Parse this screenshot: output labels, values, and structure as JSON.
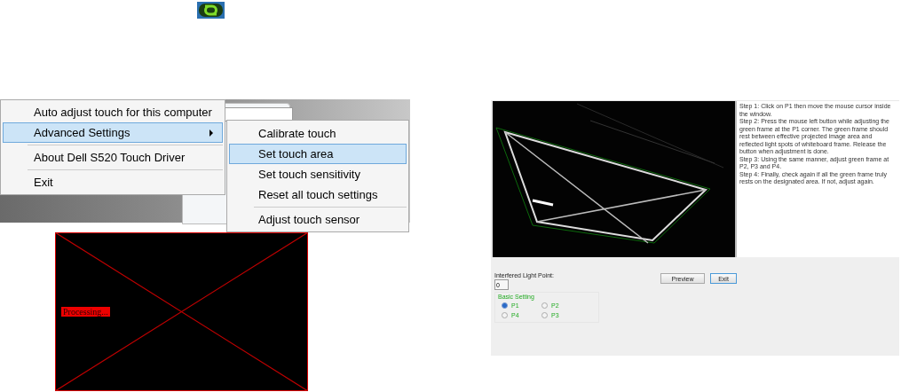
{
  "menu": {
    "groups": [
      [
        {
          "label": "Auto adjust touch for this computer",
          "selected": false,
          "has_submenu": false
        },
        {
          "label": "Advanced Settings",
          "selected": true,
          "has_submenu": true
        }
      ],
      [
        {
          "label": "About Dell S520 Touch Driver",
          "selected": false,
          "has_submenu": false
        }
      ],
      [
        {
          "label": "Exit",
          "selected": false,
          "has_submenu": false
        }
      ]
    ]
  },
  "submenu": {
    "groups": [
      [
        {
          "label": "Calibrate touch",
          "selected": false
        },
        {
          "label": "Set touch area",
          "selected": true
        },
        {
          "label": "Set touch sensitivity",
          "selected": false
        },
        {
          "label": "Reset all touch settings",
          "selected": false
        }
      ],
      [
        {
          "label": "Adjust touch sensor",
          "selected": false
        }
      ]
    ]
  },
  "processing": {
    "label": "Processing..."
  },
  "touch_area": {
    "instructions": [
      "Step 1: Click on P1 then move the mouse cursor inside the window.",
      "Step 2: Press the mouse left button while adjusting the green frame at the P1 corner. The green frame should rest between effective projected image area and reflected light spots of whiteboard frame. Release the button when adjustment is done.",
      "Step 3: Using the same manner, adjust green frame at P2, P3 and P4.",
      "Step 4: Finally, check again if all the green frame truly rests on the designated area. If not, adjust again."
    ],
    "light_point": {
      "label": "Interfered Light Point:",
      "value": "0"
    },
    "basic_setting": {
      "title": "Basic Setting",
      "options": [
        {
          "label": "P1",
          "selected": true
        },
        {
          "label": "P2",
          "selected": false
        },
        {
          "label": "P4",
          "selected": false
        },
        {
          "label": "P3",
          "selected": false
        }
      ]
    },
    "buttons": [
      "Preview",
      "Exit"
    ]
  }
}
